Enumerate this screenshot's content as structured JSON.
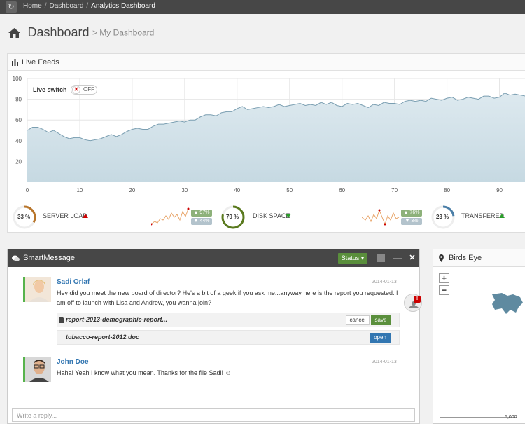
{
  "breadcrumb": [
    "Home",
    "Dashboard",
    "Analytics Dashboard"
  ],
  "page": {
    "title": "Dashboard",
    "subtitle": "> My Dashboard"
  },
  "live_feeds": {
    "title": "Live Feeds",
    "switch_label": "Live switch",
    "switch_state": "OFF"
  },
  "stats": [
    {
      "label": "SERVER LOAD",
      "percent_text": "33 %",
      "percent": 33,
      "trend": "up",
      "trend_color": "#d00000",
      "ring_color": "#b8752a",
      "badge_up": "▲ 97%",
      "badge_down": "▼ 44%"
    },
    {
      "label": "DISK SPACE",
      "percent_text": "79 %",
      "percent": 79,
      "trend": "down",
      "trend_color": "#2a9d2a",
      "ring_color": "#5a7a1e",
      "badge_up": "▲ 76%",
      "badge_down": "▼ 3%"
    },
    {
      "label": "TRANSFERED",
      "percent_text": "23 %",
      "percent": 23,
      "trend": "up",
      "trend_color": "#2a9d2a",
      "ring_color": "#4b7fa8"
    }
  ],
  "smart_message": {
    "title": "SmartMessage",
    "status_label": "Status ▾",
    "messages": [
      {
        "name": "Sadi Orlaf",
        "date": "2014-01-13",
        "text": "Hey did you meet the new board of director? He's a bit of a geek if you ask me...anyway here is the report you requested. I am off to launch with Lisa and Andrew, you wanna join?"
      },
      {
        "name": "John Doe",
        "date": "2014-01-13",
        "text": "Haha! Yeah I know what you mean. Thanks for the file Sadi! ☺"
      }
    ],
    "attachments": [
      {
        "file": "report-2013-demographic-report...",
        "cancel": "cancel",
        "save": "save"
      },
      {
        "file": "tobacco-report-2012.doc",
        "open": "open"
      }
    ],
    "reply_placeholder": "Write a reply...",
    "notification_count": "!"
  },
  "birds_eye": {
    "title": "Birds Eye",
    "zoom_in": "+",
    "zoom_out": "−",
    "scale_label": "5,000"
  },
  "colors": {
    "topbar": "#474747",
    "accent_green": "#5a8f3c",
    "link_blue": "#3276b1",
    "chart_fill": "#c6d9e2",
    "chart_line": "#7a9eb1"
  },
  "chart_data": {
    "type": "area",
    "x": [
      0,
      1,
      2,
      3,
      4,
      5,
      6,
      7,
      8,
      9,
      10,
      11,
      12,
      13,
      14,
      15,
      16,
      17,
      18,
      19,
      20,
      21,
      22,
      23,
      24,
      25,
      26,
      27,
      28,
      29,
      30,
      31,
      32,
      33,
      34,
      35,
      36,
      37,
      38,
      39,
      40,
      41,
      42,
      43,
      44,
      45,
      46,
      47,
      48,
      49,
      50,
      51,
      52,
      53,
      54,
      55,
      56,
      57,
      58,
      59,
      60,
      61,
      62,
      63,
      64,
      65,
      66,
      67,
      68,
      69,
      70,
      71,
      72,
      73,
      74,
      75,
      76,
      77,
      78,
      79,
      80,
      81,
      82,
      83,
      84,
      85,
      86,
      87,
      88,
      89,
      90,
      91,
      92,
      93,
      94,
      95
    ],
    "y": [
      50,
      53,
      53,
      51,
      48,
      50,
      47,
      44,
      42,
      43,
      43,
      41,
      40,
      41,
      42,
      44,
      46,
      44,
      46,
      49,
      51,
      52,
      51,
      51,
      54,
      56,
      56,
      57,
      58,
      59,
      58,
      60,
      60,
      63,
      65,
      65,
      64,
      67,
      68,
      68,
      71,
      73,
      70,
      71,
      72,
      73,
      72,
      73,
      75,
      73,
      74,
      75,
      76,
      74,
      75,
      74,
      77,
      75,
      77,
      74,
      73,
      76,
      75,
      76,
      74,
      72,
      75,
      74,
      77,
      76,
      76,
      75,
      78,
      79,
      78,
      79,
      78,
      81,
      80,
      79,
      81,
      82,
      79,
      80,
      82,
      81,
      80,
      83,
      83,
      81,
      82,
      86,
      84,
      85,
      84,
      83
    ],
    "xlim": [
      0,
      95
    ],
    "ylim": [
      0,
      100
    ],
    "xticks": [
      0,
      10,
      20,
      30,
      40,
      50,
      60,
      70,
      80,
      90
    ],
    "yticks": [
      20,
      40,
      60,
      80,
      100
    ],
    "grid": true
  }
}
